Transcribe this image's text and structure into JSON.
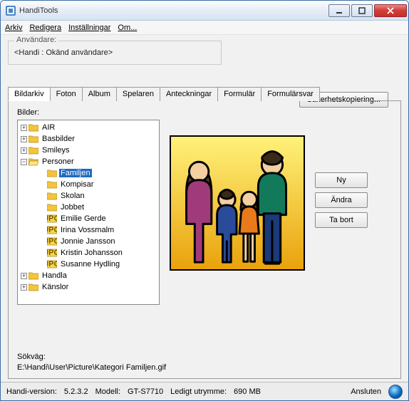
{
  "window": {
    "title": "HandiTools"
  },
  "menu": {
    "arkiv": "Arkiv",
    "redigera": "Redigera",
    "installningar": "Inställningar",
    "om": "Om..."
  },
  "user_group": {
    "legend": "Användare:",
    "value": "<Handi : Okänd användare>"
  },
  "backup_btn": "Säkerhetskopiering...",
  "tabs": {
    "bildarkiv": "Bildarkiv",
    "foton": "Foton",
    "album": "Album",
    "spelaren": "Spelaren",
    "anteckningar": "Anteckningar",
    "formular": "Formulär",
    "formularsvar": "Formulärsvar"
  },
  "bilder_label": "Bilder:",
  "tree": {
    "air": "AIR",
    "basbilder": "Basbilder",
    "smileys": "Smileys",
    "personer": "Personer",
    "familjen": "Familjen",
    "kompisar": "Kompisar",
    "skolan": "Skolan",
    "jobbet": "Jobbet",
    "emilie": "Emilie Gerde",
    "irina": "Irina Vossmalm",
    "jonnie": "Jonnie Jansson",
    "kristin": "Kristin Johansson",
    "susanne": "Susanne Hydling",
    "handla": "Handla",
    "kanslor": "Känslor"
  },
  "buttons": {
    "ny": "Ny",
    "andra": "Ändra",
    "tabort": "Ta bort"
  },
  "path_label": "Sökväg:",
  "path_value": "E:\\Handi\\User\\Picture\\Kategori Familjen.gif",
  "status": {
    "version_label": "Handi-version:",
    "version_value": "5.2.3.2",
    "model_label": "Modell:",
    "model_value": "GT-S7710",
    "space_label": "Ledigt utrymme:",
    "space_value": "690 MB",
    "conn": "Ansluten"
  }
}
